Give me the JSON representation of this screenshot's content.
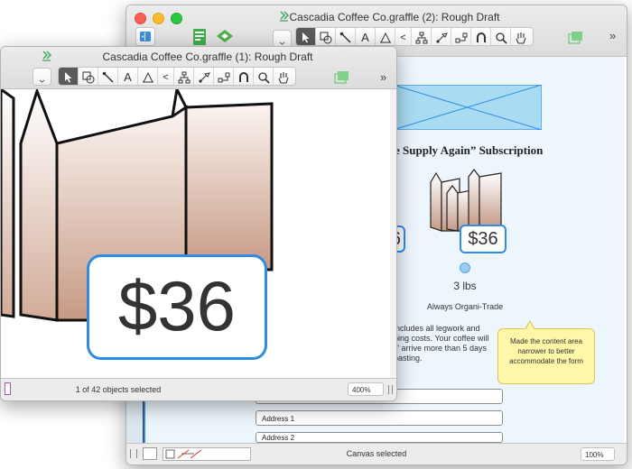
{
  "window_back": {
    "title": "Cascadia Coffee Co.graffle (2): Rough Draft",
    "status": "Canvas selected",
    "zoom": "100%",
    "more": "»"
  },
  "window_front": {
    "title": "Cascadia Coffee Co.graffle (1): Rough Draft",
    "status": "1 of 42 objects selected",
    "zoom": "400%",
    "more": "»"
  },
  "canvas": {
    "heading": "e Supply Again” Subscription",
    "price_left_partial": "6",
    "price": "$36",
    "weight": "3 lbs",
    "tagline": "Always Organi-Trade",
    "body_lines": [
      "includes all legwork and",
      "ping costs. Your coffee will",
      "r” arrive more than 5 days",
      "oasting."
    ],
    "address1_label": "Address 1",
    "address2_label": "Address 2",
    "note": "Made the content area narrower to better accommodate the form"
  },
  "zoomed": {
    "price": "$36"
  },
  "tools": {
    "text_tool": "A",
    "collapse": "<"
  },
  "icons": [
    "graffle-doc-icon",
    "sidebar-toggle-icon",
    "inspector-icon",
    "stencil-icon",
    "pointer-icon",
    "shape-icon",
    "line-icon",
    "text-icon",
    "pen-icon",
    "collapse-icon",
    "diagram-icon",
    "style-brush-icon",
    "connect-icon",
    "magnet-icon",
    "zoom-icon",
    "hand-icon",
    "browse-icon",
    "canvas-layer-icon"
  ],
  "colors": {
    "accent_blue": "#2f8be6",
    "tool_active": "#5a5a5a",
    "bag_top": "#ffffff",
    "bag_bottom": "#c49a86",
    "note_fill": "#fff6a8",
    "wireframe_fill": "#a9dcf3"
  }
}
